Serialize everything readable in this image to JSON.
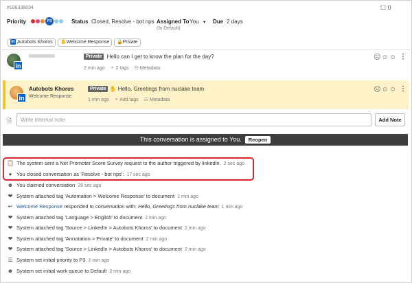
{
  "ticket": {
    "id": "#106338034",
    "bookmark_count": "0"
  },
  "header": {
    "priority_label": "Priority",
    "priority_value": "P3",
    "priority_dot_colors": [
      "#d62828",
      "#e0457b",
      "#f08a24"
    ],
    "priority_light_dot_colors": [
      "#8ec9f0",
      "#8ec9f0"
    ],
    "status_label": "Status",
    "status_value": "Closed, Resolve - bot nps",
    "assigned_label": "Assigned To",
    "assigned_value": "You",
    "assigned_note": "(In Default)",
    "due_label": "Due",
    "due_value": "2 days"
  },
  "chips": [
    {
      "label": "Autobots Khoros",
      "icon": "linkedin-icon"
    },
    {
      "label": "Welcome Response",
      "icon": "hand-wave-icon"
    },
    {
      "label": "Private",
      "icon": "lock-icon"
    }
  ],
  "messages": [
    {
      "author": "",
      "subtitle": "",
      "badge": "Private",
      "text": "Hello can I get to know the plan for the day?",
      "time": "2 min ago",
      "tags": "2 tags",
      "metadata": "Metadata"
    },
    {
      "author": "Autobots Khoros",
      "subtitle": "Welcome Response",
      "badge": "Private",
      "text": "Hello, Greetings from nuclake team",
      "time": "1 min ago",
      "tags": "Add tags",
      "metadata": "Metadata"
    }
  ],
  "note": {
    "placeholder": "Write internal note",
    "button": "Add Note"
  },
  "assign_bar": {
    "text": "This conversation is assigned to You.",
    "button": "Reopen"
  },
  "events": [
    {
      "icon": "clipboard-icon",
      "text": "The system sent a Net Promoter Score Survey request to the author triggered by linkedin.",
      "time": "2 sec ago"
    },
    {
      "icon": "chat-bubble-icon",
      "text": "You closed conversation as 'Resolve - bot nps':",
      "time": "17 sec ago"
    },
    {
      "icon": "user-icon",
      "text": "You claimed conversation",
      "time": "39 sec ago"
    },
    {
      "icon": "tag-icon",
      "text": "System attached tag 'Automation > Welcome Response' to document",
      "time": "1 min ago"
    },
    {
      "icon": "reply-icon",
      "link": "Welcome Response",
      "text": " responded to conversation with: ",
      "italic": "Hello, Greetings from nuclake team",
      "time": "1 min ago"
    },
    {
      "icon": "tag-icon",
      "text": "System attached tag 'Language > English' to document",
      "time": "2 min ago"
    },
    {
      "icon": "tag-icon",
      "text": "System attached tag 'Source > LinkedIn > Autobots Khoros' to document",
      "time": "2 min ago"
    },
    {
      "icon": "tag-icon",
      "text": "System attached tag 'Annotation > Private' to document",
      "time": "2 min ago"
    },
    {
      "icon": "tag-icon",
      "text": "System attached tag 'Source > LinkedIn > Autobots Khoros' to document",
      "time": "2 min ago"
    },
    {
      "icon": "sliders-icon",
      "text": "System set initial priority to P3",
      "time": "2 min ago"
    },
    {
      "icon": "user-icon",
      "text": "System set initial work queue to Default",
      "time": "2 min ago"
    }
  ],
  "colors": {
    "highlight_bg": "#fdf2c8",
    "highlight_border": "#f1c232",
    "accent": "#1a5fb4",
    "annotation": "#d9252b"
  }
}
